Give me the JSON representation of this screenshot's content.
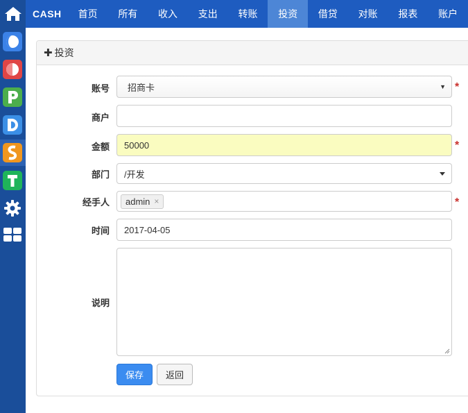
{
  "app": {
    "brand": "CASH"
  },
  "nav": {
    "items": [
      {
        "label": "首页",
        "active": false
      },
      {
        "label": "所有",
        "active": false
      },
      {
        "label": "收入",
        "active": false
      },
      {
        "label": "支出",
        "active": false
      },
      {
        "label": "转账",
        "active": false
      },
      {
        "label": "投资",
        "active": true
      },
      {
        "label": "借贷",
        "active": false
      },
      {
        "label": "对账",
        "active": false
      },
      {
        "label": "报表",
        "active": false
      },
      {
        "label": "账户",
        "active": false
      }
    ]
  },
  "sidebar": {
    "items": [
      {
        "icon": "home-icon"
      },
      {
        "letter": "C",
        "color": "#3b82e8",
        "icon": "app-c-icon"
      },
      {
        "letter": "O",
        "color": "#e04545",
        "icon": "app-o-icon"
      },
      {
        "letter": "P",
        "color": "#4cae4c",
        "icon": "app-p-icon"
      },
      {
        "letter": "D",
        "color": "#3b8fe6",
        "icon": "app-d-icon"
      },
      {
        "letter": "S",
        "color": "#f0961e",
        "icon": "app-s-icon"
      },
      {
        "letter": "T",
        "color": "#1fb45a",
        "icon": "app-t-icon"
      },
      {
        "icon": "gear-icon"
      },
      {
        "icon": "grid-icon"
      }
    ]
  },
  "panel": {
    "plus": "✚",
    "title": "投资"
  },
  "form": {
    "account": {
      "label": "账号",
      "value": "招商卡",
      "required_mark": "*"
    },
    "merchant": {
      "label": "商户",
      "value": ""
    },
    "amount": {
      "label": "金额",
      "value": "50000",
      "required_mark": "*",
      "highlight_color": "#fafcc0"
    },
    "department": {
      "label": "部门",
      "value": "/开发"
    },
    "handler": {
      "label": "经手人",
      "tag": "admin",
      "tag_remove": "×",
      "required_mark": "*"
    },
    "time": {
      "label": "时间",
      "value": "2017-04-05"
    },
    "note": {
      "label": "说明",
      "value": ""
    }
  },
  "buttons": {
    "save": "保存",
    "back": "返回"
  },
  "colors": {
    "nav_bg": "#1e5cc0",
    "nav_active": "#4d86d6",
    "sidebar_bg": "#1a4e9a",
    "primary": "#3b8cf0",
    "required": "#c9302c"
  }
}
